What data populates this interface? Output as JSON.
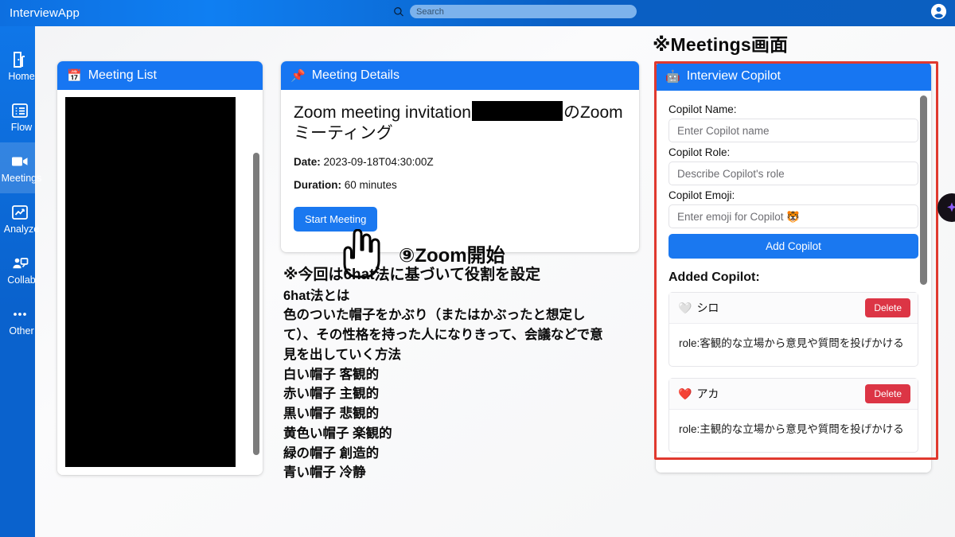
{
  "topbar": {
    "app_title": "InterviewApp",
    "search_placeholder": "Search",
    "search_value": "",
    "search_icon": "search-icon",
    "avatar_icon": "account-circle-icon"
  },
  "sidebar": {
    "items": [
      {
        "label": "Home",
        "icon": "door-home-icon",
        "active": false
      },
      {
        "label": "Flow",
        "icon": "list-flow-icon",
        "active": false
      },
      {
        "label": "Meetings",
        "icon": "video-camera-icon",
        "active": true
      },
      {
        "label": "Analyze",
        "icon": "chart-analyze-icon",
        "active": false
      },
      {
        "label": "Collab",
        "icon": "collab-person-icon",
        "active": false
      },
      {
        "label": "Other",
        "icon": "ellipsis-icon",
        "active": false
      }
    ]
  },
  "page_annotation": "※Meetings画面",
  "meeting_list": {
    "title": "Meeting List",
    "title_emoji": "📅",
    "content_redacted": true
  },
  "meeting_details": {
    "title": "Meeting Details",
    "title_emoji": "📌",
    "heading_before": "Zoom meeting invitation",
    "heading_after": "のZoomミーティング",
    "date_label": "Date:",
    "date_value": "2023-09-18T04:30:00Z",
    "duration_label": "Duration:",
    "duration_value": "60 minutes",
    "start_button": "Start Meeting"
  },
  "annotations": {
    "zoom_step": "⑨Zoom開始",
    "hat_heading": "※今回は6hat法に基づいて役割を設定",
    "hat_lines": [
      "6hat法とは",
      "色のついた帽子をかぶり（またはかぶったと想定し",
      "て）、その性格を持った人になりきって、会議などで意",
      "見を出していく方法",
      "白い帽子 客観的",
      "赤い帽子 主観的",
      "黒い帽子 悲観的",
      "黄色い帽子 楽観的",
      "緑の帽子 創造的",
      "青い帽子 冷静"
    ]
  },
  "copilot": {
    "title": "Interview Copilot",
    "title_emoji": "🤖",
    "name_label": "Copilot Name:",
    "name_placeholder": "Enter Copilot name",
    "name_value": "",
    "role_label": "Copilot Role:",
    "role_placeholder": "Describe Copilot's role",
    "role_value": "",
    "emoji_label": "Copilot Emoji:",
    "emoji_placeholder": "Enter emoji for Copilot 🐯",
    "emoji_value": "",
    "add_button": "Add Copilot",
    "added_title": "Added Copilot:",
    "delete_button": "Delete",
    "items": [
      {
        "emoji": "🤍",
        "name": "シロ",
        "role": "role:客観的な立場から意見や質問を投げかける"
      },
      {
        "emoji": "❤️",
        "name": "アカ",
        "role": "role:主観的な立場から意見や質問を投げかける"
      }
    ]
  },
  "colors": {
    "brand_blue": "#1776f2",
    "sidebar_blue": "#0a62cd",
    "annotation_red": "#e0392f",
    "delete_red": "#dc3545"
  }
}
